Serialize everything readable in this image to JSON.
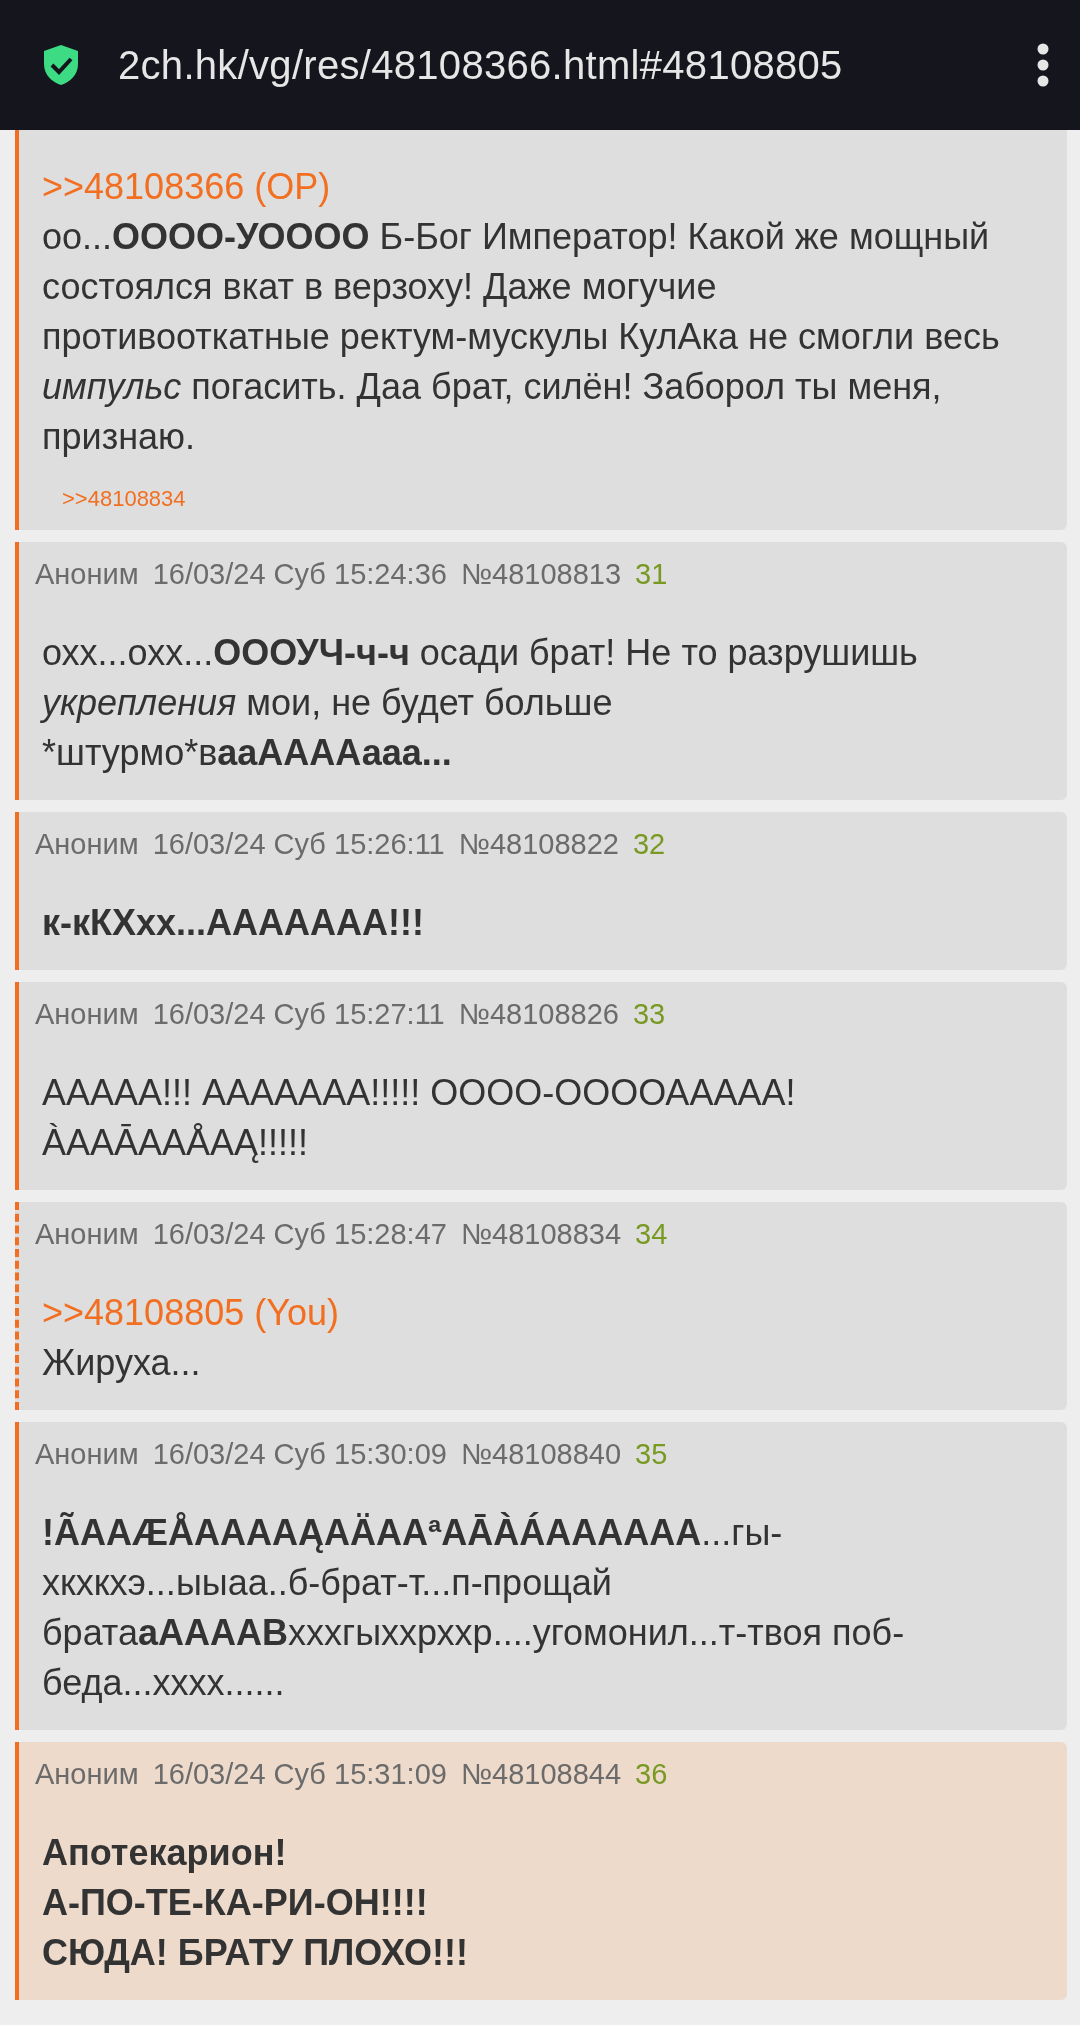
{
  "address_bar": {
    "url": "2ch.hk/vg/res/48108366.html#48108805"
  },
  "posts": [
    {
      "dashed_border": false,
      "highlighted": false,
      "bold": false,
      "reply_link": ">>48108366 (OP)",
      "lines": [
        "оо...**ОООО-УОООО** Б-Бог Император! Какой же мощный состоялся вкат в верзоху! Даже могучие противооткатные ректум-мускулы КулАка не смогли весь *импульс* погасить. Даа брат, силён! Заборол ты меня, признаю."
      ],
      "backlinks": [
        ">>48108834"
      ]
    },
    {
      "dashed_border": false,
      "highlighted": false,
      "bold": false,
      "name": "Аноним",
      "date": "16/03/24 Суб 15:24:36",
      "number": "№48108813",
      "count": "31",
      "lines": [
        "охх...охх...**ОООУЧ-ч-ч** осади брат! Не то разрушишь *укрепления* мои, не будет больше *штурмо*в**ааААААааа...**"
      ]
    },
    {
      "dashed_border": false,
      "highlighted": false,
      "bold": true,
      "name": "Аноним",
      "date": "16/03/24 Суб 15:26:11",
      "number": "№48108822",
      "count": "32",
      "lines": [
        "к-кКХхх...ААААААА!!!"
      ]
    },
    {
      "dashed_border": false,
      "highlighted": false,
      "bold": false,
      "name": "Аноним",
      "date": "16/03/24 Суб 15:27:11",
      "number": "№48108826",
      "count": "33",
      "lines": [
        "ААААА!!! ААААААА!!!!! ОООО-ООООААААА! ÀААĀААÅАĄ!!!!!"
      ]
    },
    {
      "dashed_border": true,
      "highlighted": false,
      "bold": false,
      "name": "Аноним",
      "date": "16/03/24 Суб 15:28:47",
      "number": "№48108834",
      "count": "34",
      "reply_link": ">>48108805 (You)",
      "lines": [
        "Жируха..."
      ]
    },
    {
      "dashed_border": false,
      "highlighted": false,
      "bold": false,
      "name": "Аноним",
      "date": "16/03/24 Суб 15:30:09",
      "number": "№48108840",
      "count": "35",
      "lines": [
        "**!ÃААÆÅААААĄАÄААªАĀÀÁАААААА**...гы-хкхкхэ...ыыаа..б-брат-т...п-прощай брата**аААААВ**хххгыххрххр....угомонил...т-твоя поб-беда...хххх......"
      ]
    },
    {
      "dashed_border": false,
      "highlighted": true,
      "bold": true,
      "name": "Аноним",
      "date": "16/03/24 Суб 15:31:09",
      "number": "№48108844",
      "count": "36",
      "lines": [
        "Апотекарион!",
        "А-ПО-ТЕ-КА-РИ-ОН!!!!",
        "СЮДА! БРАТУ ПЛОХО!!!"
      ]
    }
  ]
}
